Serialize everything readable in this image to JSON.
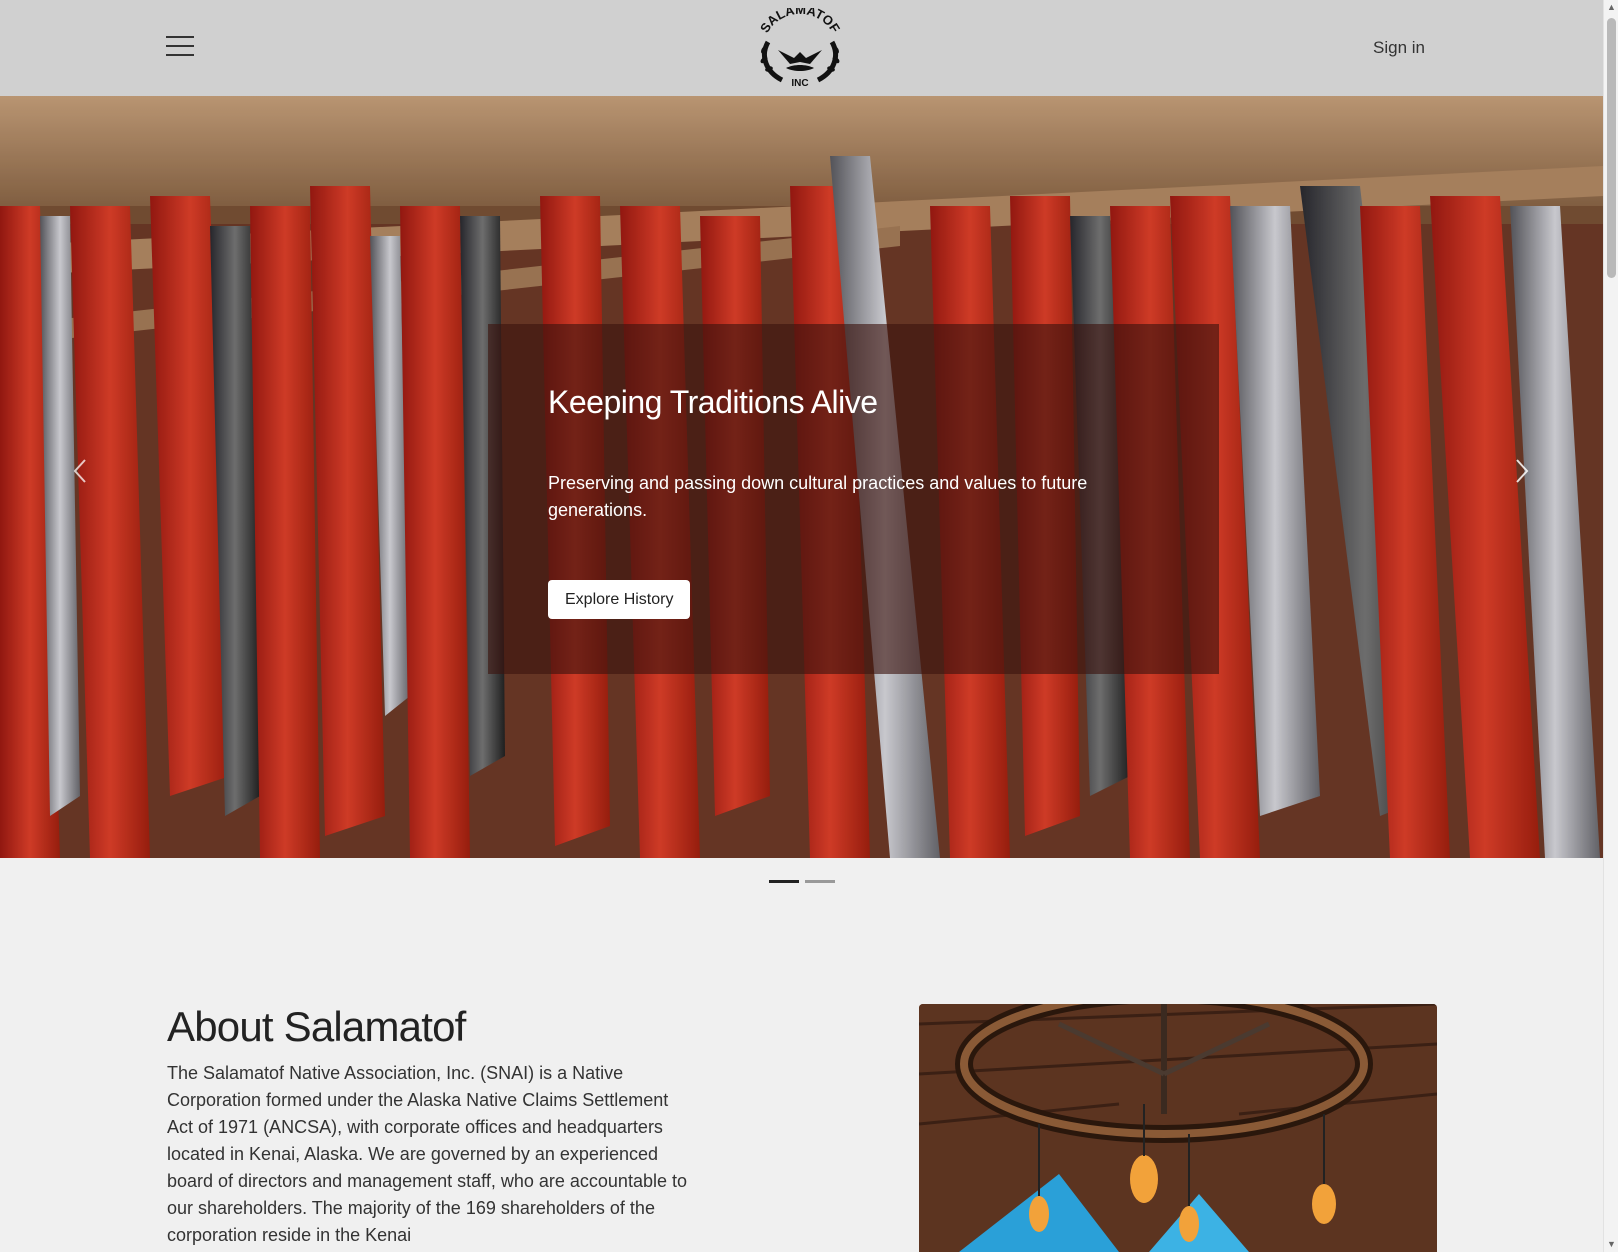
{
  "header": {
    "logo_text_top": "SALAMATOF",
    "logo_text_bottom": "INC",
    "signin_label": "Sign in"
  },
  "hero": {
    "title": "Keeping Traditions Alive",
    "text": "Preserving and passing down cultural practices and values to future generations.",
    "button_label": "Explore History",
    "slide_count": 2,
    "active_slide": 1
  },
  "about": {
    "title": "About Salamatof",
    "text": "The Salamatof Native Association, Inc. (SNAI) is a Native Corporation formed under the Alaska Native Claims Settlement Act of 1971 (ANCSA), with corporate offices and headquarters located in Kenai, Alaska.  We are governed by an experienced board of directors and management staff, who are accountable to our shareholders.  The majority of the 169 shareholders of the corporation reside in the Kenai"
  },
  "colors": {
    "header_bg": "#d0d0d0",
    "page_bg": "#f0f0f0",
    "caption_overlay": "rgba(60,20,15,0.62)"
  },
  "icons": [
    "hamburger-menu-icon",
    "chevron-left-icon",
    "chevron-right-icon"
  ]
}
